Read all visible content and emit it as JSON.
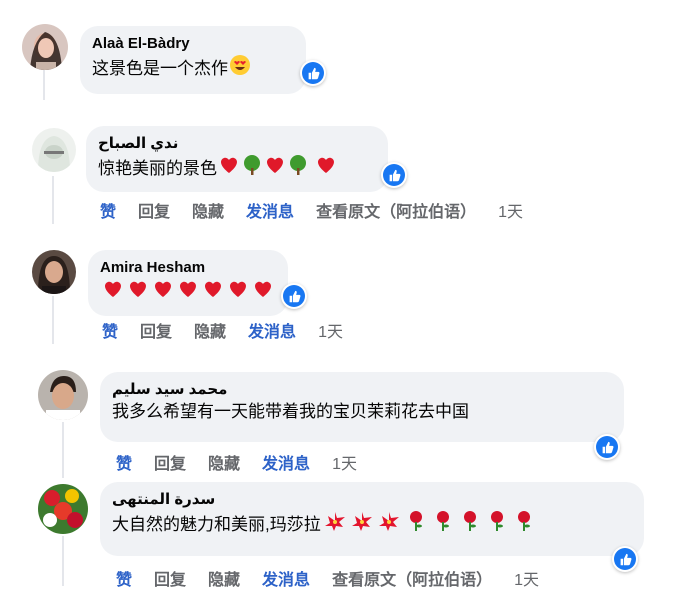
{
  "accent_color": "#1877f2",
  "comments": [
    {
      "author": "Alaà El-Bàdry",
      "text": "这景色是一个杰作",
      "emoji": [
        "heart-eyes-emoji"
      ],
      "reaction": "like"
    },
    {
      "author": "ندي الصباح",
      "text": "惊艳美丽的景色",
      "emoji": [
        "heart",
        "tree",
        "heart",
        "tree",
        "heart"
      ],
      "reaction": "like",
      "actions": {
        "like": "赞",
        "reply": "回复",
        "hide": "隐藏",
        "message": "发消息",
        "see_original": "查看原文（阿拉伯语）",
        "time": "1天"
      }
    },
    {
      "author": "Amira Hesham",
      "text": "",
      "emoji": [
        "heart",
        "heart",
        "heart",
        "heart",
        "heart",
        "heart",
        "heart"
      ],
      "reaction": "like",
      "actions": {
        "like": "赞",
        "reply": "回复",
        "hide": "隐藏",
        "message": "发消息",
        "time": "1天"
      }
    },
    {
      "author": "محمد سيد سليم",
      "text": "我多么希望有一天能带着我的宝贝茉莉花去中国",
      "emoji": [],
      "reaction": "like",
      "actions": {
        "like": "赞",
        "reply": "回复",
        "hide": "隐藏",
        "message": "发消息",
        "time": "1天"
      }
    },
    {
      "author": "سدرة المنتهى",
      "text": "大自然的魅力和美丽,玛莎拉",
      "emoji": [
        "hibiscus",
        "hibiscus",
        "hibiscus",
        "rose",
        "rose",
        "rose",
        "rose",
        "rose"
      ],
      "reaction": "like",
      "actions": {
        "like": "赞",
        "reply": "回复",
        "hide": "隐藏",
        "message": "发消息",
        "see_original": "查看原文（阿拉伯语）",
        "time": "1天"
      }
    }
  ]
}
